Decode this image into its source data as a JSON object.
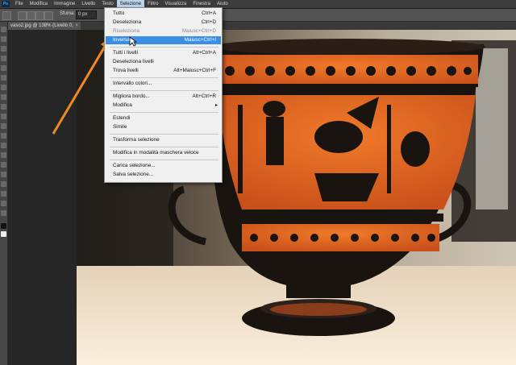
{
  "app": {
    "logo": "Ps"
  },
  "menubar": {
    "items": [
      "File",
      "Modifica",
      "Immagine",
      "Livello",
      "Testo",
      "Selezione",
      "Filtro",
      "Visualizza",
      "Finestra",
      "Aiuto"
    ],
    "active_index": 5
  },
  "options": {
    "feather_label": "Sfuma:",
    "feather_value": "0 px"
  },
  "document": {
    "tab_label": "vaso2.jpg @ 138% (Livello 0, RGB/8) *",
    "close": "×"
  },
  "selection_menu": {
    "items": [
      {
        "label": "Tutto",
        "shortcut": "Ctrl+A"
      },
      {
        "label": "Deseleziona",
        "shortcut": "Ctrl+D"
      },
      {
        "label": "Riseleziona",
        "shortcut": "Maiusc+Ctrl+D"
      },
      {
        "label": "Inversa",
        "shortcut": "Maiusc+Ctrl+I"
      },
      {
        "label": "Tutti i livelli",
        "shortcut": "Alt+Ctrl+A"
      },
      {
        "label": "Deseleziona livelli",
        "shortcut": ""
      },
      {
        "label": "Trova livelli",
        "shortcut": "Alt+Maiusc+Ctrl+F"
      },
      {
        "label": "Intervallo colori...",
        "shortcut": ""
      },
      {
        "label": "Migliora bordo...",
        "shortcut": "Alt+Ctrl+R"
      },
      {
        "label": "Modifica",
        "shortcut": ""
      },
      {
        "label": "Estendi",
        "shortcut": ""
      },
      {
        "label": "Simile",
        "shortcut": ""
      },
      {
        "label": "Trasforma selezione",
        "shortcut": ""
      },
      {
        "label": "Modifica in modalità maschera veloce",
        "shortcut": ""
      },
      {
        "label": "Carica selezione...",
        "shortcut": ""
      },
      {
        "label": "Salva selezione...",
        "shortcut": ""
      }
    ],
    "submenu_arrow": "▸",
    "disabled_index": 2,
    "highlight_index": 3
  },
  "colors": {
    "highlight": "#3a8ee6",
    "annotation_arrow": "#f08a24",
    "vase_orange": "#e8641e",
    "vase_black": "#1a1410"
  }
}
